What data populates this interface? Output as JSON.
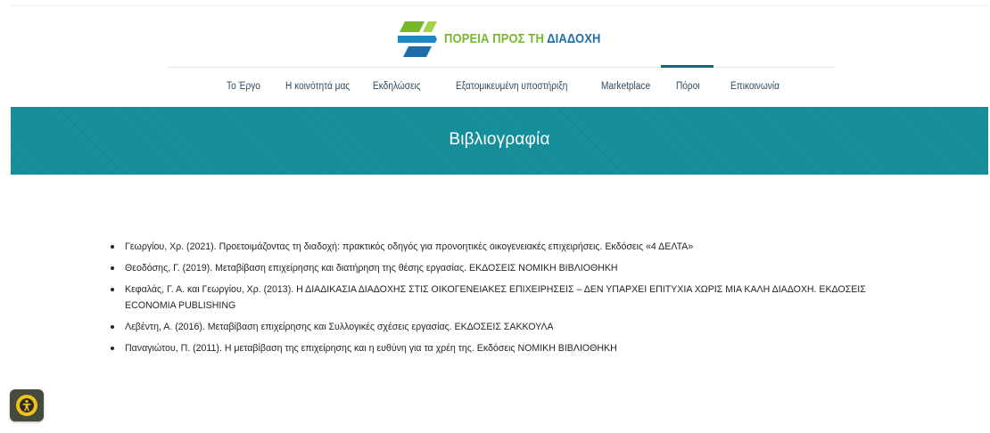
{
  "logo": {
    "text_green": "ΠΟΡΕΙΑ ΠΡΟΣ ΤΗ",
    "text_blue": "ΔΙΑΔΟΧΗ",
    "colors": {
      "green": "#76b82a",
      "blue": "#1f6ea8"
    }
  },
  "nav": {
    "items": [
      {
        "label": "Το Έργο"
      },
      {
        "label": "Η κοινότητά μας"
      },
      {
        "label": "Εκδηλώσεις"
      },
      {
        "label": "Εξατομικευμένη υποστήριξη"
      },
      {
        "label": "Marketplace"
      },
      {
        "label": "Πόροι"
      },
      {
        "label": "Επικοινωνία"
      }
    ],
    "active_label": "Πόροι",
    "active_color": "#1d6273"
  },
  "banner": {
    "title": "Βιβλιογραφία",
    "color": "#138e99"
  },
  "bibliography": [
    "Γεωργίου, Χρ. (2021). Προετοιμάζοντας τη διαδοχή: πρακτικός οδηγός για προνοητικές οικογενειακές επιχειρήσεις. Εκδόσεις «4 ΔΕΛΤΑ»",
    "Θεοδόσης, Γ. (2019). Μεταβίβαση επιχείρησης και διατήρηση της θέσης εργασίας. ΕΚΔΟΣΕΙΣ ΝΟΜΙΚΗ ΒΙΒΛΙΟΘΗΚΗ",
    "Κεφαλάς, Γ. Α. και Γεωργίου, Χρ. (2013). Η ΔΙΑΔΙΚΑΣΙΑ ΔΙΑΔΟΧΗΣ ΣΤΙΣ ΟΙΚΟΓΕΝΕΙΑΚΕΣ ΕΠΙΧΕΙΡΗΣΕΙΣ – ΔΕΝ ΥΠΑΡΧΕΙ ΕΠΙΤΥΧΙΑ ΧΩΡΙΣ ΜΙΑ ΚΑΛΗ ΔΙΑΔΟΧΗ. ΕΚΔΟΣΕΙΣ ECONOMIA PUBLISHING",
    "Λεβέντη, Α. (2016). Μεταβίβαση επιχείρησης και Συλλογικές σχέσεις εργασίας.  ΕΚΔΟΣΕΙΣ ΣΑΚΚΟΥΛΑ",
    "Παναγιώτου, Π. (2011). Η μεταβίβαση της επιχείρησης και η ευθύνη για τα χρέη της. Εκδόσεις ΝΟΜΙΚΗ ΒΙΒΛΙΟΘΗΚΗ"
  ],
  "accessibility_button": {
    "icon": "accessibility-icon",
    "colors": {
      "background": "#454a3f",
      "ring": "#f2c21b"
    }
  }
}
